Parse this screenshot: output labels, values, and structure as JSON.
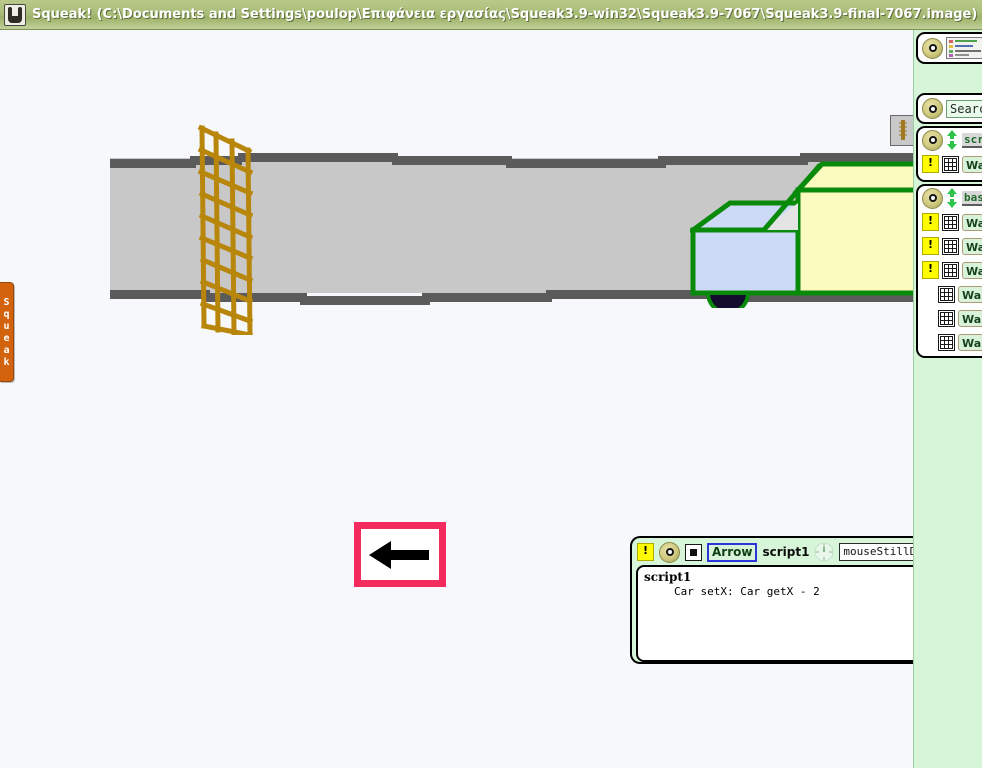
{
  "window": {
    "title": "Squeak! (C:\\Documents and Settings\\poulop\\Επιφάνεια εργασίας\\Squeak3.9-win32\\Squeak3.9-7067\\Squeak3.9-final-7067.image)",
    "logo_icon": "squeak-mouse-icon",
    "titlebar_color": "#aabd79",
    "desktop_color": "#f7f8fc"
  },
  "left_flap": {
    "name": "Squeak",
    "letters": [
      "S",
      "q",
      "u",
      "e",
      "a",
      "k"
    ],
    "color": "#d2620c"
  },
  "stage": {
    "road": {
      "name": "road",
      "surface_color": "#c8c8c8",
      "edge_color": "#5b5b5b"
    },
    "fence": {
      "name": "Wall lattice fence",
      "color": "#b8860b",
      "rows": 9,
      "cols": 4
    },
    "car": {
      "name": "Car",
      "outline_color": "#0a8a0a",
      "cab_color": "#ccd9f7",
      "trailer_color": "#fbfbc0",
      "wheel_color": "#140d2e"
    },
    "arrow_button": {
      "name": "left arrow button",
      "glyph": "←",
      "border_color": "#f42b5e",
      "fill_color": "#ffffff"
    },
    "paint_tab": {
      "name": "paint-tab",
      "icon": "paintbrush-icon"
    }
  },
  "viewer": {
    "background": "#d6f5d9",
    "panes": [
      {
        "id": "thumbnail-pane",
        "halo_icon": "halo-dot-icon",
        "thumbnail": "world-thumbnail",
        "grid_icon": "grid-icon"
      },
      {
        "id": "search-pane",
        "halo_icon": "halo-dot-icon",
        "search_value": "Search",
        "search_placeholder": "Search"
      },
      {
        "id": "scripts-pane",
        "halo_icon": "halo-dot-icon",
        "arrows_icon": "up-down-arrows-icon",
        "category": "scri",
        "rows": [
          {
            "bang": "!",
            "icon": "grid-icon",
            "label": "Wall"
          }
        ]
      },
      {
        "id": "basic-pane",
        "halo_icon": "halo-dot-icon",
        "arrows_icon": "up-down-arrows-icon",
        "category": "basi",
        "rows": [
          {
            "bang": "!",
            "icon": "grid-icon",
            "label": "Wall"
          },
          {
            "bang": "!",
            "icon": "grid-icon",
            "label": "Wall"
          },
          {
            "bang": "!",
            "icon": "grid-icon",
            "label": "Wall"
          },
          {
            "bang": "",
            "icon": "grid-icon",
            "label": "Wall's"
          },
          {
            "bang": "",
            "icon": "grid-icon",
            "label": "Wall's"
          },
          {
            "bang": "",
            "icon": "grid-icon",
            "label": "Wall's"
          }
        ]
      }
    ]
  },
  "script_editor": {
    "bang_label": "!",
    "halo_icon": "halo-dot-icon",
    "stop_icon": "stop-square-icon",
    "actor": "Arrow",
    "script_name": "script1",
    "clock_icon": "clock-icon",
    "trigger": "mouseStillDown",
    "menu_icon": "menu-icon",
    "close_icon": "✕",
    "body_title": "script1",
    "body_code": "Car setX: Car getX - 2",
    "scroll": {
      "up_glyph": "▲",
      "down_glyph": "▼",
      "thumb": "scroll-thumb"
    }
  }
}
